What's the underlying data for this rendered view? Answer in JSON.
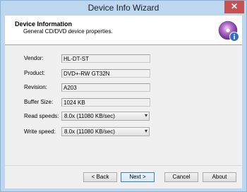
{
  "window": {
    "title": "Device Info Wizard",
    "close_glyph": "✕"
  },
  "header": {
    "title": "Device Information",
    "subtitle": "General CD/DVD device properties.",
    "icon": "disc-info-icon"
  },
  "fields": {
    "vendor": {
      "label": "Vendor:",
      "value": "HL-DT-ST"
    },
    "product": {
      "label": "Product:",
      "value": "DVD+-RW GT32N"
    },
    "revision": {
      "label": "Revision:",
      "value": "A203"
    },
    "buffer": {
      "label": "Buffer Size:",
      "value": "1024 KB"
    },
    "read_speeds": {
      "label": "Read speeds:",
      "value": "8.0x (11080 KB/sec)"
    },
    "write_speed": {
      "label": "Write speed:",
      "value": "8.0x (11080 KB/sec)"
    }
  },
  "buttons": {
    "back": "< Back",
    "next": "Next >",
    "cancel": "Cancel",
    "about": "About"
  },
  "colors": {
    "titlebar": "#bcd7ef",
    "close": "#c75050",
    "client": "#f0f0f0"
  }
}
